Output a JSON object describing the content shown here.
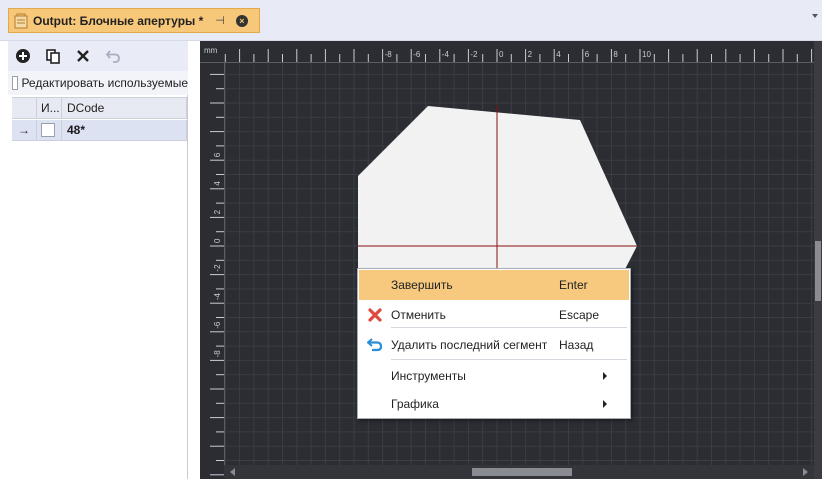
{
  "tab": {
    "title": "Output: Блочные апертуры *",
    "pin_glyph": "⊣",
    "close_glyph": "×"
  },
  "toolbar": {
    "buttons": [
      "add-icon",
      "copy-icon",
      "delete-icon",
      "undo-icon"
    ]
  },
  "panel": {
    "edit_used_label": "Редактировать используемые",
    "columns": [
      "И...",
      "DCode"
    ],
    "rows": [
      {
        "indicator": "→",
        "dcode": "48*"
      }
    ]
  },
  "canvas": {
    "unit": "mm",
    "x_ticks": [
      "-8",
      "-6",
      "-4",
      "-2",
      "0",
      "2",
      "4",
      "6",
      "8",
      "10"
    ],
    "y_ticks": [
      "6",
      "4",
      "2",
      "0",
      "-2",
      "-4",
      "-6",
      "-8"
    ],
    "colors": {
      "background": "#2b2d33",
      "grid": "#3a3d45",
      "shape": "#f2f2f2",
      "crosshair": "#8a1010",
      "ruler": "#2b2d33"
    }
  },
  "context_menu": {
    "items": [
      {
        "label": "Завершить",
        "shortcut": "Enter",
        "icon": "",
        "highlighted": true
      },
      {
        "label": "Отменить",
        "shortcut": "Escape",
        "icon": "cancel-x-icon"
      },
      {
        "label": "Удалить последний сегмент",
        "shortcut": "Назад",
        "icon": "undo-arrow-icon"
      },
      {
        "label": "Инструменты",
        "shortcut": "",
        "icon": "",
        "submenu": true
      },
      {
        "label": "Графика",
        "shortcut": "",
        "icon": "",
        "submenu": true
      }
    ]
  }
}
